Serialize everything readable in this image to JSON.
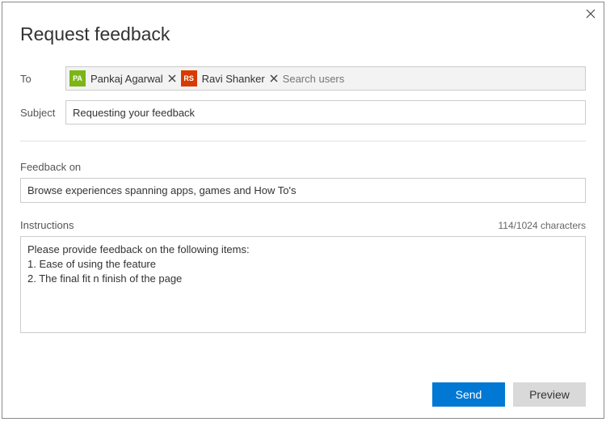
{
  "title": "Request feedback",
  "labels": {
    "to": "To",
    "subject": "Subject",
    "feedbackOn": "Feedback on",
    "instructions": "Instructions"
  },
  "to": {
    "chips": [
      {
        "initials": "PA",
        "name": "Pankaj Agarwal",
        "color": "#7cb518"
      },
      {
        "initials": "RS",
        "name": "Ravi Shanker",
        "color": "#d83b01"
      }
    ],
    "placeholder": "Search users"
  },
  "subject": "Requesting your feedback",
  "feedbackOn": "Browse experiences spanning apps, games and How To's",
  "instructions": {
    "counter": "114/1024 characters",
    "text": "Please provide feedback on the following items:\n1. Ease of using the feature\n2. The final fit n finish of the page"
  },
  "buttons": {
    "send": "Send",
    "preview": "Preview"
  }
}
